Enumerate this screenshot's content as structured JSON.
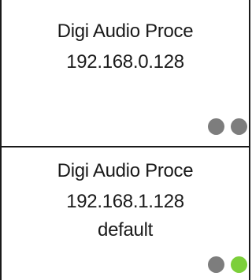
{
  "devices": [
    {
      "name": "Digi Audio Proce",
      "ip": "192.168.0.128",
      "status": [
        "gray",
        "gray"
      ]
    },
    {
      "name": "Digi Audio Proce",
      "ip": "192.168.1.128",
      "preset": "default",
      "status": [
        "gray",
        "green"
      ]
    }
  ],
  "colors": {
    "status_offline": "#7d7d7d",
    "status_online": "#7ccf3a",
    "border": "#1a1a1a"
  }
}
